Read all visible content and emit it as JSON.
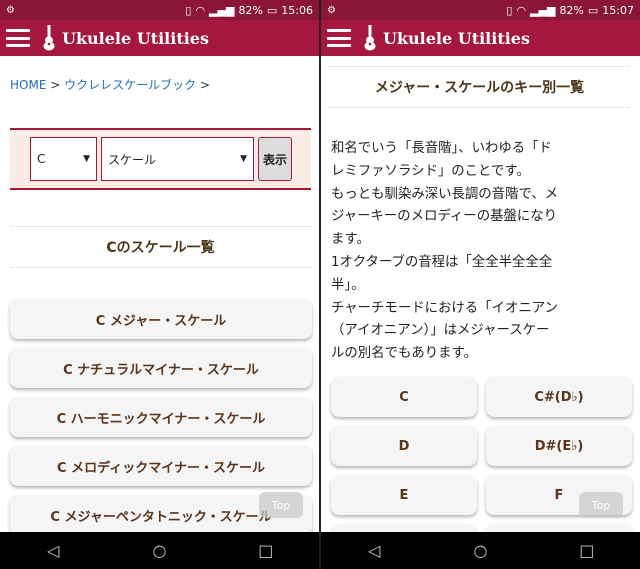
{
  "status_left": {
    "icon": "notification-icon",
    "battery": "82%",
    "time": "15:06"
  },
  "status_right": {
    "icon": "notification-icon",
    "battery": "82%",
    "time": "15:07"
  },
  "app_title": "Ukulele Utilities",
  "breadcrumb": {
    "home": "HOME",
    "sep1": ">",
    "section": "ウクレレスケールブック",
    "sep2": ">"
  },
  "selector": {
    "key": "C",
    "type": "スケール",
    "show": "表示"
  },
  "left_section_title": "Cのスケール一覧",
  "scales": [
    "C メジャー・スケール",
    "C ナチュラルマイナー・スケール",
    "C ハーモニックマイナー・スケール",
    "C メロディックマイナー・スケール",
    "C メジャーペンタトニック・スケール"
  ],
  "top_label": "Top",
  "right_section_title": "メジャー・スケールのキー別一覧",
  "description": [
    "和名でいう「長音階」、いわゆる「ド",
    "レミファソラシド」のことです。",
    "もっとも馴染み深い長調の音階で、メ",
    "ジャーキーのメロディーの基盤になり",
    "ます。",
    "1オクターブの音程は「全全半全全全",
    "半」。",
    "チャーチモードにおける「イオニアン",
    "（アイオニアン）」はメジャースケー",
    "ルの別名でもあります。"
  ],
  "keys": [
    "C",
    "C#(D♭)",
    "D",
    "D#(E♭)",
    "E",
    "F"
  ]
}
